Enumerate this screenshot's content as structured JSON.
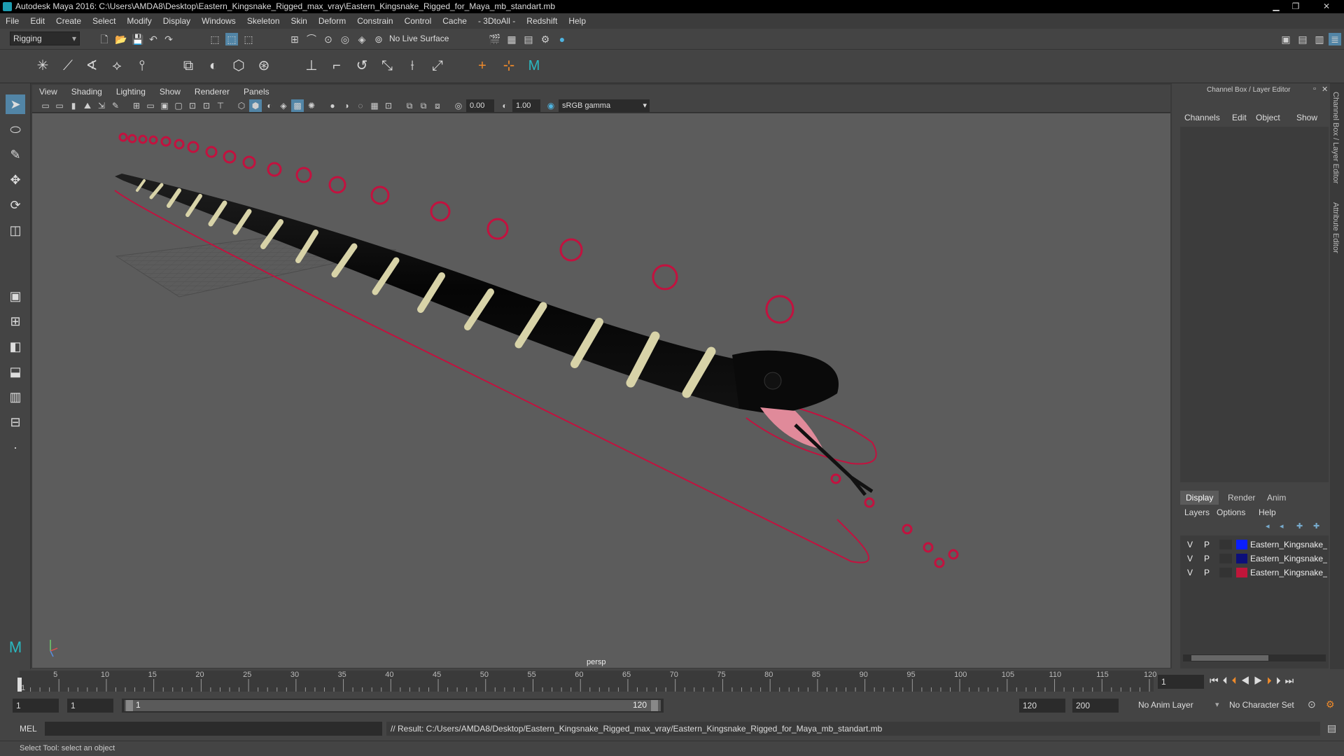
{
  "window": {
    "title": "Autodesk Maya 2016: C:\\Users\\AMDA8\\Desktop\\Eastern_Kingsnake_Rigged_max_vray\\Eastern_Kingsnake_Rigged_for_Maya_mb_standart.mb"
  },
  "menubar": [
    "File",
    "Edit",
    "Create",
    "Select",
    "Modify",
    "Display",
    "Windows",
    "Skeleton",
    "Skin",
    "Deform",
    "Constrain",
    "Control",
    "Cache",
    "- 3DtoAll -",
    "Redshift",
    "Help"
  ],
  "statusline": {
    "menuset": "Rigging",
    "live_surface": "No Live Surface"
  },
  "panel": {
    "menus": [
      "View",
      "Shading",
      "Lighting",
      "Show",
      "Renderer",
      "Panels"
    ],
    "exposure": "0.00",
    "gamma": "1.00",
    "colorspace": "sRGB gamma",
    "camera": "persp"
  },
  "channelbox": {
    "header": "Channel Box / Layer Editor",
    "menus": [
      "Channels",
      "Edit",
      "Object",
      "Show"
    ],
    "tabs": [
      "Display",
      "Render",
      "Anim"
    ],
    "active_tab": "Display",
    "layer_menus": [
      "Layers",
      "Options",
      "Help"
    ],
    "layers": [
      {
        "v": "V",
        "p": "P",
        "name": "Eastern_Kingsnake_Rig",
        "color": "#0a1eff"
      },
      {
        "v": "V",
        "p": "P",
        "name": "Eastern_Kingsnake_bo",
        "color": "#0c0f7a"
      },
      {
        "v": "V",
        "p": "P",
        "name": "Eastern_Kingsnake_co",
        "color": "#c0163a"
      }
    ]
  },
  "sidetabs": [
    "Channel Box / Layer Editor",
    "Attribute Editor"
  ],
  "timeline": {
    "ticks": [
      "1",
      "5",
      "10",
      "15",
      "20",
      "25",
      "30",
      "35",
      "40",
      "45",
      "50",
      "55",
      "60",
      "65",
      "70",
      "75",
      "80",
      "85",
      "90",
      "95",
      "100",
      "105",
      "110",
      "115",
      "120"
    ],
    "current_frame": "1"
  },
  "range": {
    "start": "1",
    "playback_start": "1",
    "slider_start": "1",
    "slider_end": "120",
    "playback_end": "120",
    "end": "200",
    "anim_layer": "No Anim Layer",
    "character_set": "No Character Set"
  },
  "command": {
    "lang": "MEL",
    "result": "// Result: C:/Users/AMDA8/Desktop/Eastern_Kingsnake_Rigged_max_vray/Eastern_Kingsnake_Rigged_for_Maya_mb_standart.mb"
  },
  "helpline": "Select Tool: select an object",
  "colors": {
    "controls": "#c2123f",
    "viewport_bg": "#5c5c5c",
    "snake_body": "#0b0b0b",
    "snake_bands": "#d8d3a8"
  }
}
